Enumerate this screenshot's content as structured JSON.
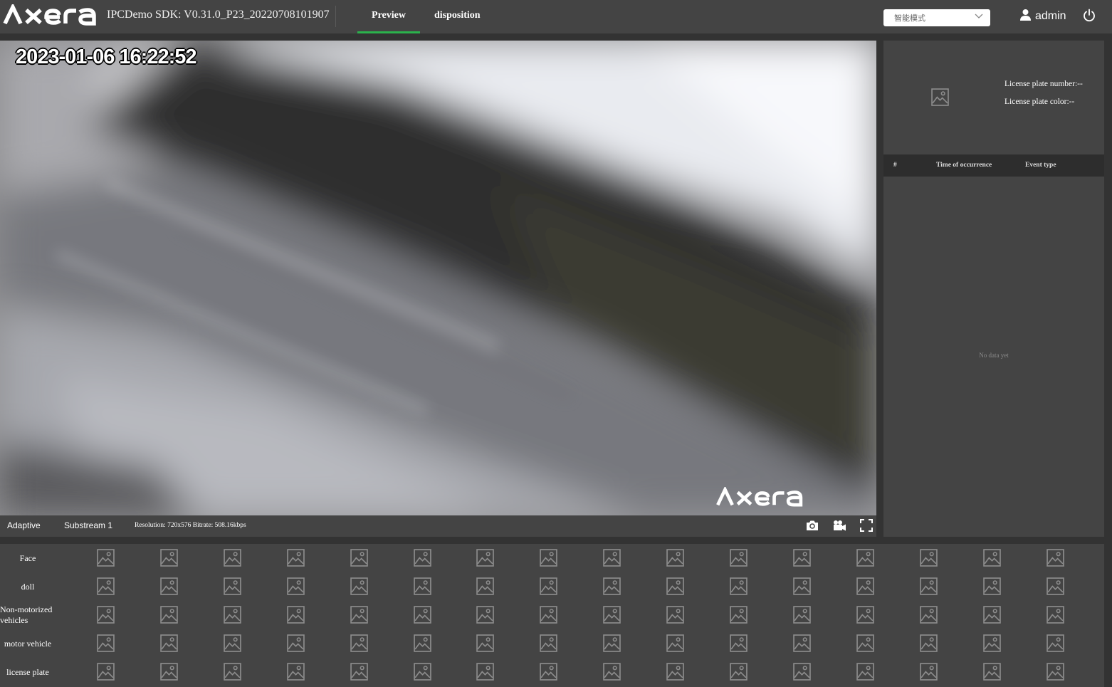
{
  "header": {
    "logo_text": "AXERA",
    "app_title": "IPCDemo SDK: V0.31.0_P23_20220708101907",
    "tabs": [
      {
        "label": "Preview",
        "active": true
      },
      {
        "label": "disposition",
        "active": false
      }
    ],
    "mode_select": {
      "value": "智能模式"
    },
    "user": {
      "name": "admin",
      "icon": "user-icon"
    },
    "power_icon": "power-icon",
    "accent_color": "#2bb24c"
  },
  "video": {
    "timestamp": "2023-01-06 16:22:52",
    "watermark": "AXERA"
  },
  "video_toolbar": {
    "adaptive_label": "Adaptive",
    "substream_label": "Substream 1",
    "info": "Resolution: 720x576 Bitrate: 508.16kbps",
    "icons": [
      "camera-icon",
      "video-record-icon",
      "fullscreen-icon"
    ]
  },
  "plate_panel": {
    "number_label": "License plate number:--",
    "color_label": "License plate color:--",
    "image_icon": "image-placeholder-icon"
  },
  "events_table": {
    "columns": [
      "#",
      "Time of occurrence",
      "Event type"
    ],
    "empty_text": "No data yet"
  },
  "capture_grid": {
    "rows": [
      {
        "label": "Face"
      },
      {
        "label": "doll"
      },
      {
        "label": "Non-motorized vehicles"
      },
      {
        "label": "motor vehicle"
      },
      {
        "label": "license plate"
      }
    ],
    "thumbs_per_row": 16,
    "thumb_icon": "image-placeholder-icon"
  }
}
